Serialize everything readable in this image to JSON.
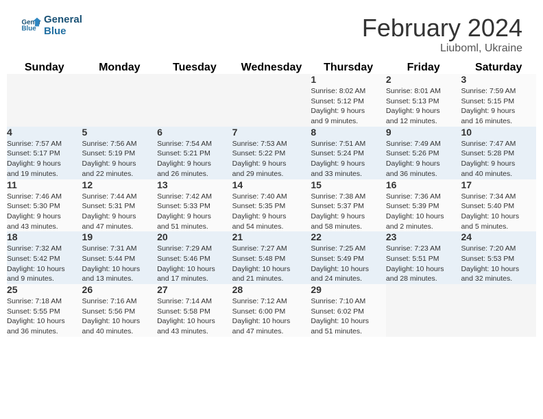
{
  "header": {
    "logo_line1": "General",
    "logo_line2": "Blue",
    "month_title": "February 2024",
    "location": "Liuboml, Ukraine"
  },
  "weekdays": [
    "Sunday",
    "Monday",
    "Tuesday",
    "Wednesday",
    "Thursday",
    "Friday",
    "Saturday"
  ],
  "weeks": [
    [
      {
        "day": "",
        "info": ""
      },
      {
        "day": "",
        "info": ""
      },
      {
        "day": "",
        "info": ""
      },
      {
        "day": "",
        "info": ""
      },
      {
        "day": "1",
        "info": "Sunrise: 8:02 AM\nSunset: 5:12 PM\nDaylight: 9 hours\nand 9 minutes."
      },
      {
        "day": "2",
        "info": "Sunrise: 8:01 AM\nSunset: 5:13 PM\nDaylight: 9 hours\nand 12 minutes."
      },
      {
        "day": "3",
        "info": "Sunrise: 7:59 AM\nSunset: 5:15 PM\nDaylight: 9 hours\nand 16 minutes."
      }
    ],
    [
      {
        "day": "4",
        "info": "Sunrise: 7:57 AM\nSunset: 5:17 PM\nDaylight: 9 hours\nand 19 minutes."
      },
      {
        "day": "5",
        "info": "Sunrise: 7:56 AM\nSunset: 5:19 PM\nDaylight: 9 hours\nand 22 minutes."
      },
      {
        "day": "6",
        "info": "Sunrise: 7:54 AM\nSunset: 5:21 PM\nDaylight: 9 hours\nand 26 minutes."
      },
      {
        "day": "7",
        "info": "Sunrise: 7:53 AM\nSunset: 5:22 PM\nDaylight: 9 hours\nand 29 minutes."
      },
      {
        "day": "8",
        "info": "Sunrise: 7:51 AM\nSunset: 5:24 PM\nDaylight: 9 hours\nand 33 minutes."
      },
      {
        "day": "9",
        "info": "Sunrise: 7:49 AM\nSunset: 5:26 PM\nDaylight: 9 hours\nand 36 minutes."
      },
      {
        "day": "10",
        "info": "Sunrise: 7:47 AM\nSunset: 5:28 PM\nDaylight: 9 hours\nand 40 minutes."
      }
    ],
    [
      {
        "day": "11",
        "info": "Sunrise: 7:46 AM\nSunset: 5:30 PM\nDaylight: 9 hours\nand 43 minutes."
      },
      {
        "day": "12",
        "info": "Sunrise: 7:44 AM\nSunset: 5:31 PM\nDaylight: 9 hours\nand 47 minutes."
      },
      {
        "day": "13",
        "info": "Sunrise: 7:42 AM\nSunset: 5:33 PM\nDaylight: 9 hours\nand 51 minutes."
      },
      {
        "day": "14",
        "info": "Sunrise: 7:40 AM\nSunset: 5:35 PM\nDaylight: 9 hours\nand 54 minutes."
      },
      {
        "day": "15",
        "info": "Sunrise: 7:38 AM\nSunset: 5:37 PM\nDaylight: 9 hours\nand 58 minutes."
      },
      {
        "day": "16",
        "info": "Sunrise: 7:36 AM\nSunset: 5:39 PM\nDaylight: 10 hours\nand 2 minutes."
      },
      {
        "day": "17",
        "info": "Sunrise: 7:34 AM\nSunset: 5:40 PM\nDaylight: 10 hours\nand 5 minutes."
      }
    ],
    [
      {
        "day": "18",
        "info": "Sunrise: 7:32 AM\nSunset: 5:42 PM\nDaylight: 10 hours\nand 9 minutes."
      },
      {
        "day": "19",
        "info": "Sunrise: 7:31 AM\nSunset: 5:44 PM\nDaylight: 10 hours\nand 13 minutes."
      },
      {
        "day": "20",
        "info": "Sunrise: 7:29 AM\nSunset: 5:46 PM\nDaylight: 10 hours\nand 17 minutes."
      },
      {
        "day": "21",
        "info": "Sunrise: 7:27 AM\nSunset: 5:48 PM\nDaylight: 10 hours\nand 21 minutes."
      },
      {
        "day": "22",
        "info": "Sunrise: 7:25 AM\nSunset: 5:49 PM\nDaylight: 10 hours\nand 24 minutes."
      },
      {
        "day": "23",
        "info": "Sunrise: 7:23 AM\nSunset: 5:51 PM\nDaylight: 10 hours\nand 28 minutes."
      },
      {
        "day": "24",
        "info": "Sunrise: 7:20 AM\nSunset: 5:53 PM\nDaylight: 10 hours\nand 32 minutes."
      }
    ],
    [
      {
        "day": "25",
        "info": "Sunrise: 7:18 AM\nSunset: 5:55 PM\nDaylight: 10 hours\nand 36 minutes."
      },
      {
        "day": "26",
        "info": "Sunrise: 7:16 AM\nSunset: 5:56 PM\nDaylight: 10 hours\nand 40 minutes."
      },
      {
        "day": "27",
        "info": "Sunrise: 7:14 AM\nSunset: 5:58 PM\nDaylight: 10 hours\nand 43 minutes."
      },
      {
        "day": "28",
        "info": "Sunrise: 7:12 AM\nSunset: 6:00 PM\nDaylight: 10 hours\nand 47 minutes."
      },
      {
        "day": "29",
        "info": "Sunrise: 7:10 AM\nSunset: 6:02 PM\nDaylight: 10 hours\nand 51 minutes."
      },
      {
        "day": "",
        "info": ""
      },
      {
        "day": "",
        "info": ""
      }
    ]
  ]
}
